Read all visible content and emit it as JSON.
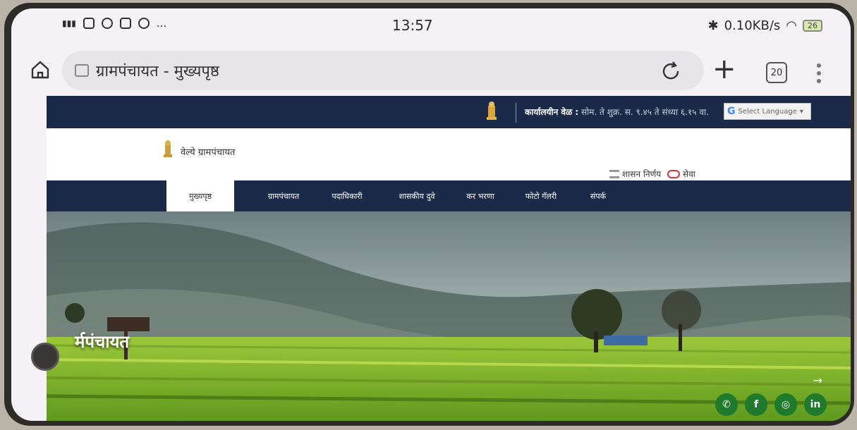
{
  "status_bar": {
    "time": "13:57",
    "network_speed": "0.10KB/s",
    "battery": "26",
    "left_icons": [
      "signal-icon",
      "facebook-icon",
      "whatsapp-icon",
      "app-icon",
      "whatsapp-icon"
    ],
    "more_glyph": "..."
  },
  "browser": {
    "url_title": "ग्रामपंचायत - मुख्यपृष्ठ",
    "tab_count": "20",
    "plus_label": "+"
  },
  "site": {
    "office_hours_label": "कार्यालयीन वेळ :",
    "office_hours_value": "सोम. ते शुक्र. स. ९.४५ ते संध्या ६.१५ वा.",
    "language_select": "Select Language",
    "gp_name": "वेल्ये ग्रामपंचायत",
    "links": {
      "gov_decision": "शासन निर्णय",
      "seva": "सेवा"
    },
    "nav": [
      {
        "label": "मुख्यपृष्ठ",
        "active": true
      },
      {
        "label": "ग्रामपंचायत"
      },
      {
        "label": "पदाधिकारी"
      },
      {
        "label": "शासकीय दुवे"
      },
      {
        "label": "कर भरणा"
      },
      {
        "label": "फोटो गॅलरी"
      },
      {
        "label": "संपर्क"
      }
    ],
    "hero_caption": "र्मपंचायत",
    "social": [
      {
        "name": "whatsapp",
        "glyph": "✆"
      },
      {
        "name": "facebook",
        "glyph": "f"
      },
      {
        "name": "instagram",
        "glyph": "◎"
      },
      {
        "name": "linkedin",
        "glyph": "in"
      }
    ],
    "colors": {
      "nav_bg": "#1b2a48",
      "social_bg": "#1f7a2c",
      "field_green": "#8fcc2a"
    }
  }
}
